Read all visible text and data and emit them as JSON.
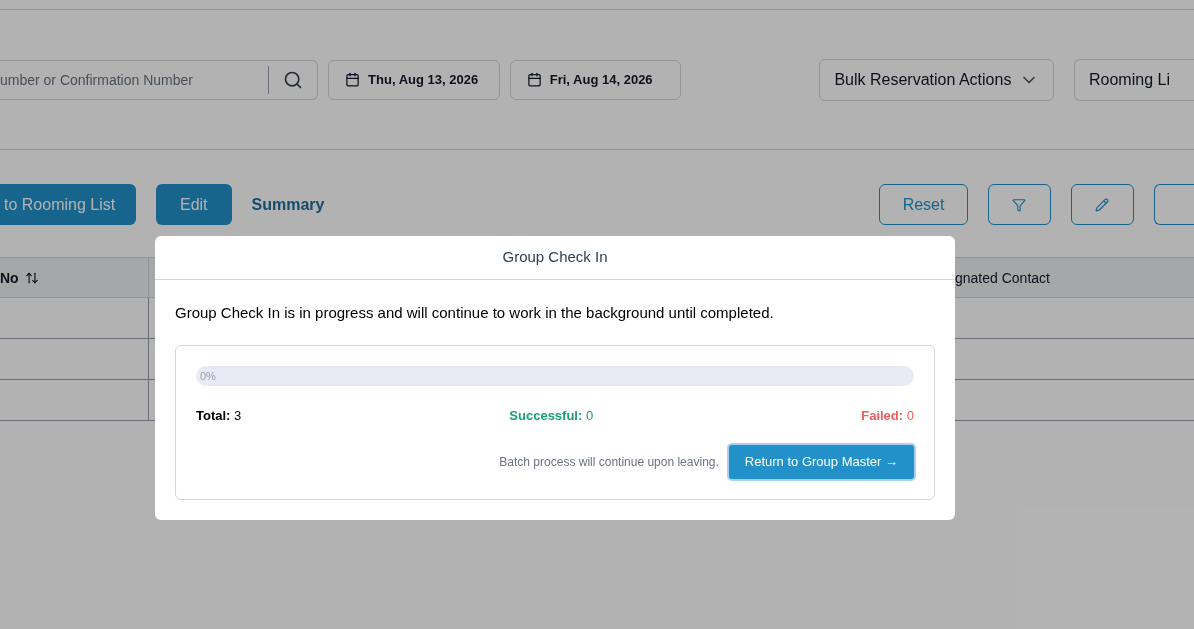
{
  "toolbar": {
    "search": {
      "placeholder": "umber or Confirmation Number"
    },
    "dates": [
      "Thu, Aug 13, 2026",
      "Fri, Aug 14, 2026"
    ],
    "bulk_actions": "Bulk Reservation Actions",
    "rooming_list": "Rooming Li"
  },
  "actions": {
    "add_button": "to Rooming List",
    "edit_button": "Edit",
    "summary_link": "Summary",
    "reset_button": "Reset"
  },
  "table": {
    "columns": [
      "No",
      "gnated Contact"
    ],
    "row_count_rows": [
      {},
      {},
      {}
    ]
  },
  "dialog": {
    "title": "Group Check In",
    "message": "Group Check In is in progress and will continue to work in the background until completed.",
    "progress": {
      "level": 0,
      "label": "0%"
    },
    "stats": [
      {
        "kind": "total",
        "label": "Total:",
        "value": "3"
      },
      {
        "kind": "successful",
        "label": "Successful:",
        "value": "0"
      },
      {
        "kind": "failed",
        "label": "Failed:",
        "value": "0"
      }
    ],
    "note": "Batch process will continue upon leaving.",
    "button": "Return to Group Master",
    "button_arrow": "→"
  }
}
